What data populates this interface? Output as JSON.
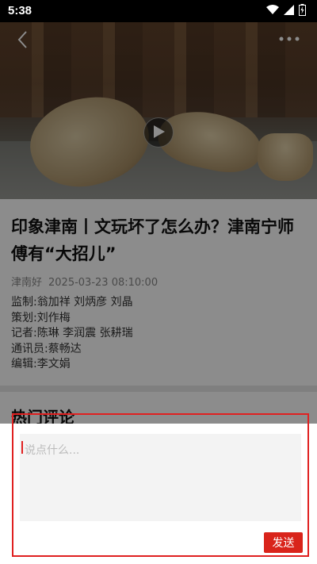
{
  "status": {
    "time": "5:38"
  },
  "video": {
    "has_play_button": true
  },
  "article": {
    "title": "印象津南丨文玩坏了怎么办？津南宁师傅有“大招儿”",
    "source": "津南好",
    "datetime": "2025-03-23 08:10:00",
    "credits": [
      "监制:翁加祥 刘炳彦 刘晶",
      "策划:刘作梅",
      "记者:陈琳 李润震 张耕瑞",
      "通讯员:蔡畅达",
      "编辑:李文娟"
    ]
  },
  "comments": {
    "title": "热门评论"
  },
  "comment_input": {
    "placeholder": "说点什么...",
    "send_label": "发送"
  },
  "colors": {
    "accent": "#d9241b",
    "highlight": "#e02020"
  }
}
